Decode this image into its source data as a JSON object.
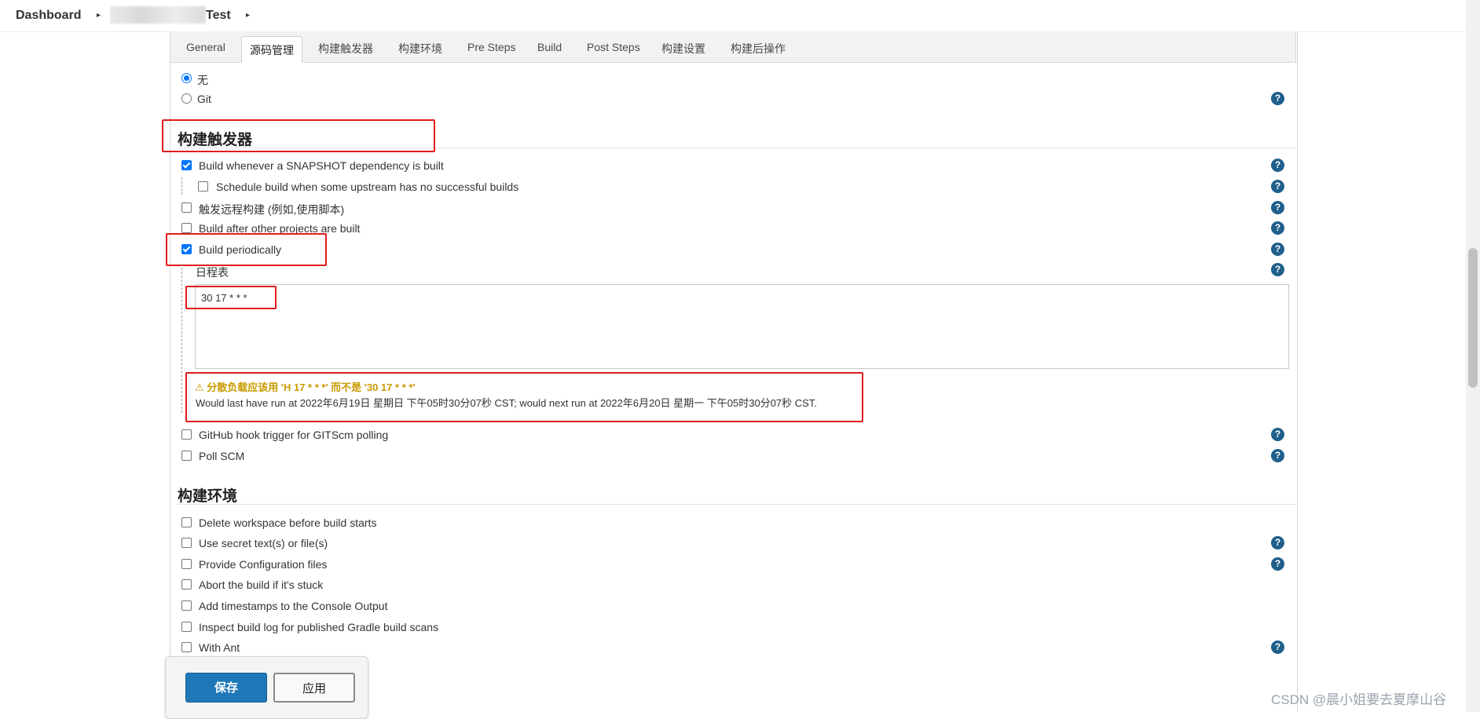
{
  "breadcrumb": {
    "dashboard": "Dashboard",
    "job": "Test",
    "sep": "▸"
  },
  "tabs": [
    "General",
    "源码管理",
    "构建触发器",
    "构建环境",
    "Pre Steps",
    "Build",
    "Post Steps",
    "构建设置",
    "构建后操作"
  ],
  "scm": {
    "none": "无",
    "git": "Git"
  },
  "triggers": {
    "title": "构建触发器",
    "snapshot": "Build whenever a SNAPSHOT dependency is built",
    "upstream": "Schedule build when some upstream has no successful builds",
    "remote": "触发远程构建 (例如,使用脚本)",
    "after_other": "Build after other projects are built",
    "periodic": "Build periodically",
    "schedule_label": "日程表",
    "schedule_value": "30 17 * * *",
    "warning": "⚠ 分散负载应该用 'H 17 * * *' 而不是 '30 17 * * *'",
    "info": "Would last have run at 2022年6月19日 星期日 下午05时30分07秒 CST; would next run at 2022年6月20日 星期一 下午05时30分07秒 CST.",
    "github": "GitHub hook trigger for GITScm polling",
    "poll": "Poll SCM"
  },
  "env": {
    "title": "构建环境",
    "items": [
      "Delete workspace before build starts",
      "Use secret text(s) or file(s)",
      "Provide Configuration files",
      "Abort the build if it's stuck",
      "Add timestamps to the Console Output",
      "Inspect build log for published Gradle build scans",
      "With Ant"
    ]
  },
  "buttons": {
    "save": "保存",
    "apply": "应用"
  },
  "help_glyph": "?",
  "watermark": "CSDN @晨小姐要去夏摩山谷",
  "colors": {
    "accent": "#0075ff",
    "save": "#1e78b8",
    "highlight": "#e21b1b",
    "warning": "#c89a00"
  }
}
